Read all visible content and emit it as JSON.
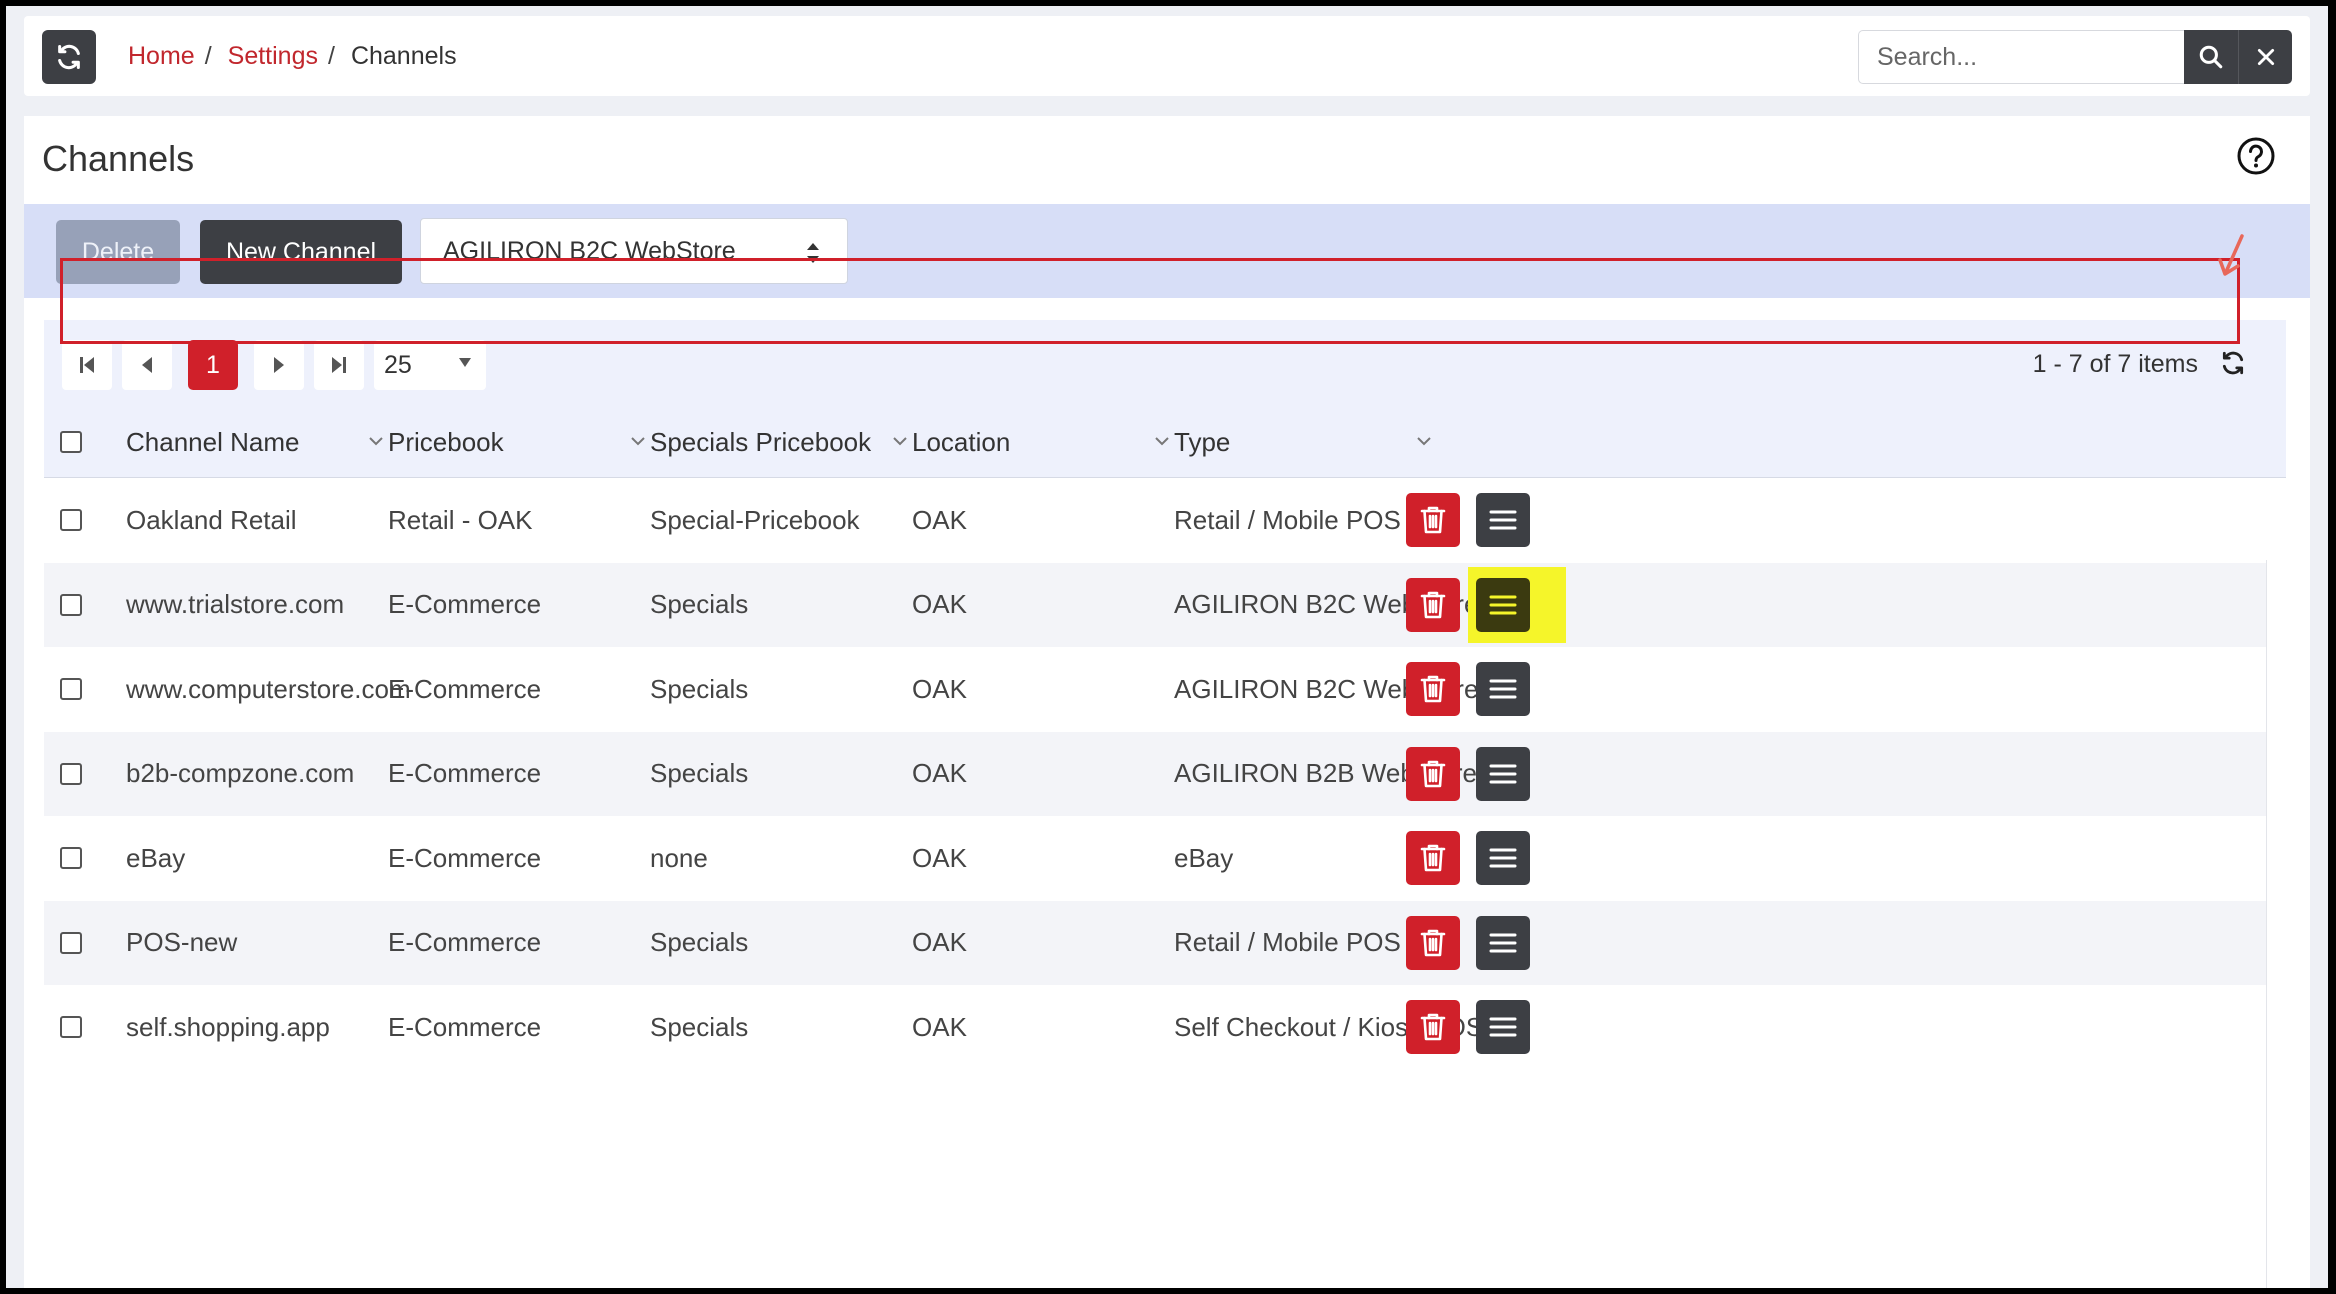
{
  "breadcrumb": {
    "home": "Home",
    "settings": "Settings",
    "current": "Channels",
    "separator": "/"
  },
  "search": {
    "placeholder": "Search..."
  },
  "page": {
    "title": "Channels"
  },
  "toolbar": {
    "delete_label": "Delete",
    "new_label": "New Channel",
    "type_filter": "AGILIRON B2C WebStore"
  },
  "pager": {
    "current_page": "1",
    "page_size": "25",
    "info": "1 - 7 of 7 items"
  },
  "columns": [
    "Channel Name",
    "Pricebook",
    "Specials Pricebook",
    "Location",
    "Type"
  ],
  "rows": [
    {
      "name": "Oakland Retail",
      "pricebook": "Retail - OAK",
      "specials": "Special-Pricebook",
      "location": "OAK",
      "type": "Retail / Mobile POS"
    },
    {
      "name": "www.trialstore.com",
      "pricebook": "E-Commerce",
      "specials": "Specials",
      "location": "OAK",
      "type": "AGILIRON B2C WebStore"
    },
    {
      "name": "www.computerstore.com",
      "pricebook": "E-Commerce",
      "specials": "Specials",
      "location": "OAK",
      "type": "AGILIRON B2C WebStore"
    },
    {
      "name": "b2b-compzone.com",
      "pricebook": "E-Commerce",
      "specials": "Specials",
      "location": "OAK",
      "type": "AGILIRON B2B WebStore"
    },
    {
      "name": "eBay",
      "pricebook": "E-Commerce",
      "specials": "none",
      "location": "OAK",
      "type": "eBay"
    },
    {
      "name": "POS-new",
      "pricebook": "E-Commerce",
      "specials": "Specials",
      "location": "OAK",
      "type": "Retail / Mobile POS"
    },
    {
      "name": "self.shopping.app",
      "pricebook": "E-Commerce",
      "specials": "Specials",
      "location": "OAK",
      "type": "Self Checkout / Kiosk POS"
    }
  ],
  "highlight": {
    "row_index": 1,
    "color": "#f5f52a",
    "outline_color": "#d0202a"
  },
  "colors": {
    "accent_red": "#d0202a",
    "dark_button": "#3d3f44",
    "toolbar_bg": "#d7def7",
    "link_red": "#c1272d"
  },
  "icons": {
    "refresh": "refresh-icon",
    "search": "search-icon",
    "close": "close-icon",
    "help": "help-circle-icon",
    "delete": "trash-icon",
    "menu": "hamburger-menu-icon"
  }
}
